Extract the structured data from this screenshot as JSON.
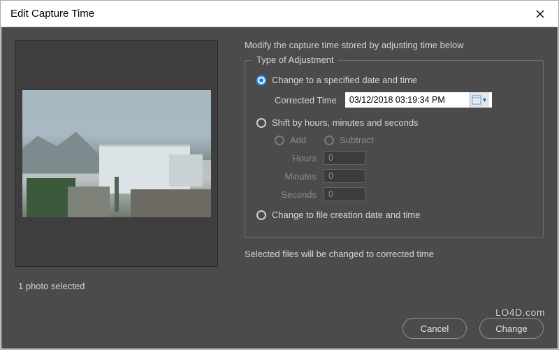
{
  "window": {
    "title": "Edit Capture Time"
  },
  "left": {
    "caption": "1 photo selected"
  },
  "main": {
    "instruction": "Modify the capture time stored by adjusting time below",
    "fieldset_legend": "Type of Adjustment",
    "option_specified": {
      "label": "Change to a specified date and time",
      "corrected_time_label": "Corrected Time",
      "corrected_time_value": "03/12/2018  03:19:34 PM"
    },
    "option_shift": {
      "label": "Shift by hours, minutes and seconds",
      "add_label": "Add",
      "subtract_label": "Subtract",
      "hours_label": "Hours",
      "minutes_label": "Minutes",
      "seconds_label": "Seconds",
      "hours_value": "0",
      "minutes_value": "0",
      "seconds_value": "0"
    },
    "option_filecreation": {
      "label": "Change to file creation date and time"
    },
    "footer_note": "Selected files will be changed to corrected time"
  },
  "buttons": {
    "cancel": "Cancel",
    "change": "Change"
  },
  "watermark": "LO4D.com"
}
